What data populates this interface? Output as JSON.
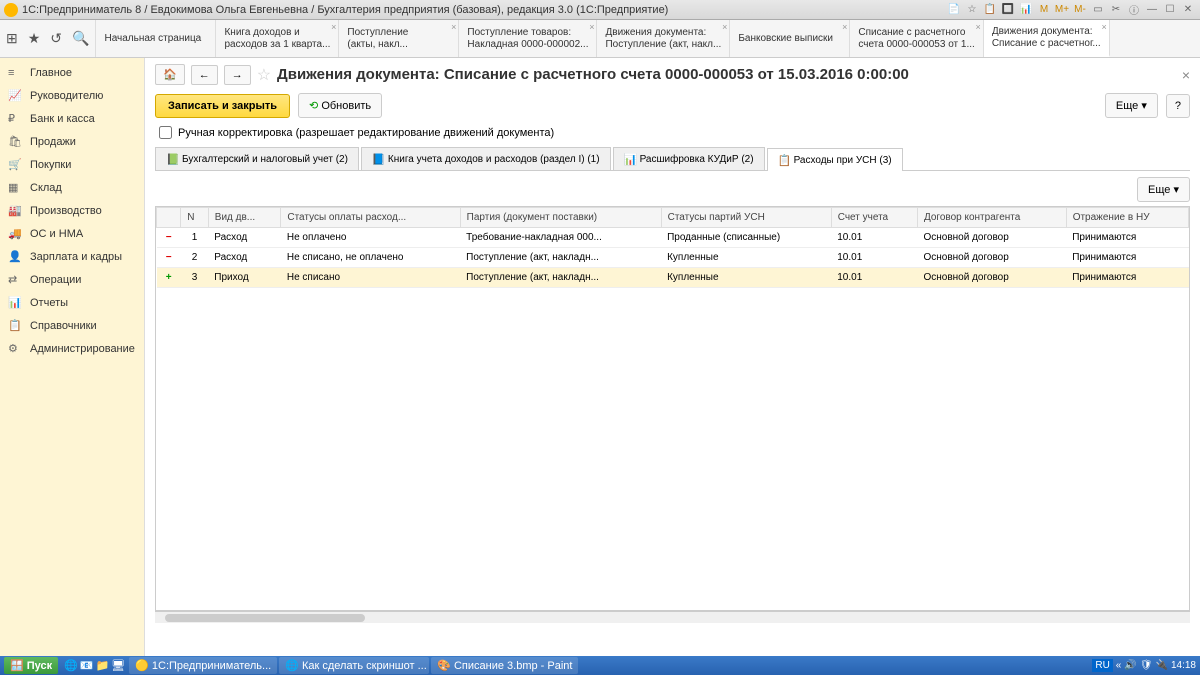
{
  "titlebar": {
    "text": "1С:Предприниматель 8 / Евдокимова Ольга Евгеньевна / Бухгалтерия предприятия (базовая), редакция 3.0  (1С:Предприятие)",
    "icons_m": [
      "M",
      "M+",
      "M-"
    ]
  },
  "top_tabs": [
    {
      "title": "Начальная страница",
      "sub": ""
    },
    {
      "title": "Книга доходов и",
      "sub": "расходов за 1 кварта..."
    },
    {
      "title": "Поступление",
      "sub": "(акты, накл..."
    },
    {
      "title": "Поступление товаров:",
      "sub": "Накладная 0000-000002..."
    },
    {
      "title": "Движения документа:",
      "sub": "Поступление (акт, накл..."
    },
    {
      "title": "Банковские выписки",
      "sub": ""
    },
    {
      "title": "Списание с расчетного",
      "sub": "счета 0000-000053 от 1..."
    },
    {
      "title": "Движения документа:",
      "sub": "Списание с расчетног..."
    }
  ],
  "sidebar": {
    "items": [
      {
        "icon": "≡",
        "label": "Главное"
      },
      {
        "icon": "📈",
        "label": "Руководителю"
      },
      {
        "icon": "₽",
        "label": "Банк и касса"
      },
      {
        "icon": "🛍",
        "label": "Продажи"
      },
      {
        "icon": "🛒",
        "label": "Покупки"
      },
      {
        "icon": "▦",
        "label": "Склад"
      },
      {
        "icon": "🏭",
        "label": "Производство"
      },
      {
        "icon": "🚚",
        "label": "ОС и НМА"
      },
      {
        "icon": "👤",
        "label": "Зарплата и кадры"
      },
      {
        "icon": "⇄",
        "label": "Операции"
      },
      {
        "icon": "📊",
        "label": "Отчеты"
      },
      {
        "icon": "📋",
        "label": "Справочники"
      },
      {
        "icon": "⚙",
        "label": "Администрирование"
      }
    ]
  },
  "page": {
    "title": "Движения документа: Списание с расчетного счета 0000-000053 от 15.03.2016 0:00:00",
    "save_close": "Записать и закрыть",
    "refresh": "Обновить",
    "more": "Еще",
    "help": "?",
    "manual_edit": "Ручная корректировка (разрешает редактирование движений документа)"
  },
  "inner_tabs": [
    "Бухгалтерский и налоговый учет (2)",
    "Книга учета доходов и расходов (раздел I) (1)",
    "Расшифровка КУДиР (2)",
    "Расходы при УСН (3)"
  ],
  "table": {
    "headers": [
      "",
      "N",
      "Вид дв...",
      "Статусы оплаты расход...",
      "Партия (документ поставки)",
      "Статусы партий УСН",
      "Счет учета",
      "Договор контрагента",
      "Отражение в НУ"
    ],
    "rows": [
      {
        "sign": "−",
        "n": "1",
        "kind": "Расход",
        "status": "Не оплачено",
        "party": "Требование-накладная 000...",
        "usn": "Проданные (списанные)",
        "acct": "10.01",
        "contract": "Основной договор",
        "refl": "Принимаются"
      },
      {
        "sign": "−",
        "n": "2",
        "kind": "Расход",
        "status": "Не списано, не оплачено",
        "party": "Поступление (акт, накладн...",
        "usn": "Купленные",
        "acct": "10.01",
        "contract": "Основной договор",
        "refl": "Принимаются"
      },
      {
        "sign": "+",
        "n": "3",
        "kind": "Приход",
        "status": "Не списано",
        "party": "Поступление (акт, накладн...",
        "usn": "Купленные",
        "acct": "10.01",
        "contract": "Основной договор",
        "refl": "Принимаются"
      }
    ]
  },
  "taskbar": {
    "start": "Пуск",
    "items": [
      "1С:Предприниматель...",
      "Как сделать скриншот ...",
      "Списание 3.bmp - Paint"
    ],
    "lang": "RU",
    "time": "14:18"
  }
}
